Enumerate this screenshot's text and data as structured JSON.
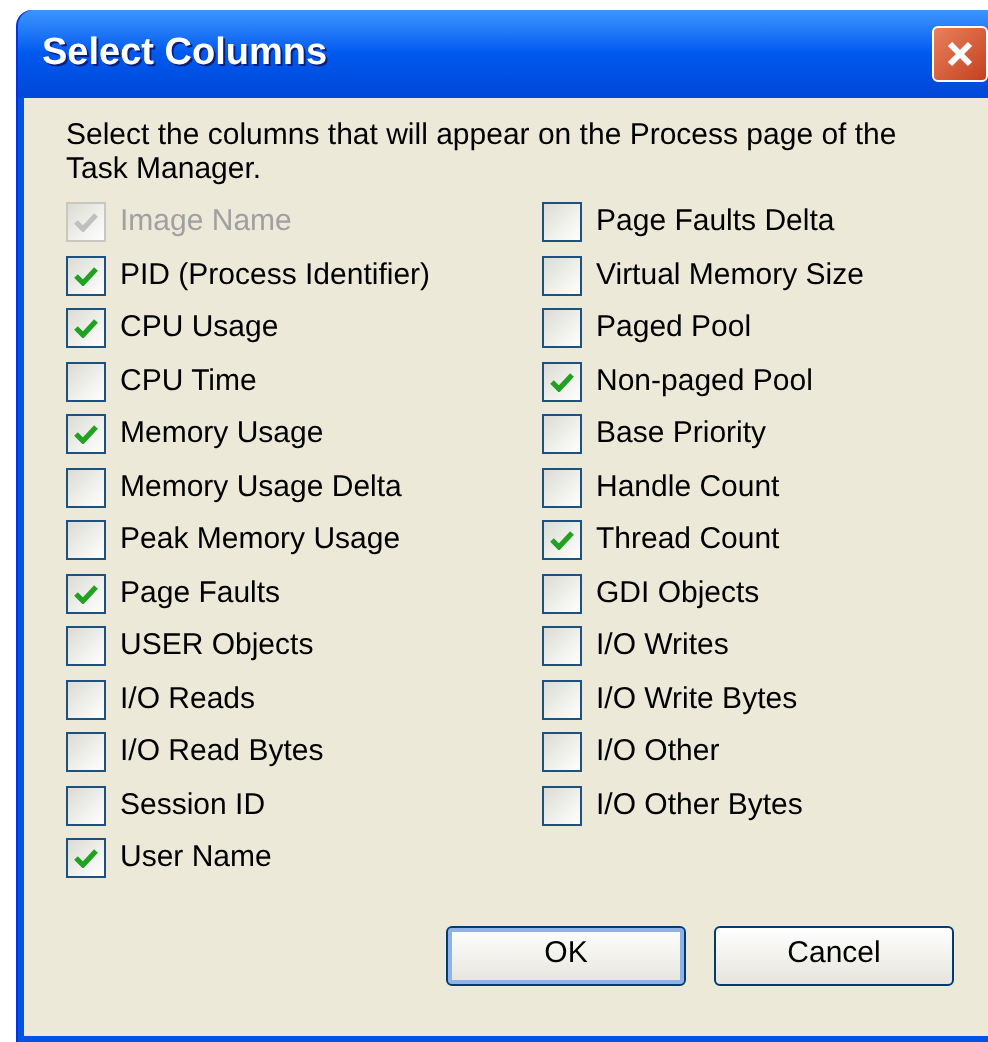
{
  "window": {
    "title": "Select Columns"
  },
  "instructions": "Select the columns that will appear on the Process page of the Task Manager.",
  "columns_left": [
    {
      "label": "Image Name",
      "checked": true,
      "disabled": true
    },
    {
      "label": "PID (Process Identifier)",
      "checked": true,
      "disabled": false
    },
    {
      "label": "CPU Usage",
      "checked": true,
      "disabled": false
    },
    {
      "label": "CPU Time",
      "checked": false,
      "disabled": false
    },
    {
      "label": "Memory Usage",
      "checked": true,
      "disabled": false
    },
    {
      "label": "Memory Usage Delta",
      "checked": false,
      "disabled": false
    },
    {
      "label": "Peak Memory Usage",
      "checked": false,
      "disabled": false
    },
    {
      "label": "Page Faults",
      "checked": true,
      "disabled": false
    },
    {
      "label": "USER Objects",
      "checked": false,
      "disabled": false
    },
    {
      "label": "I/O Reads",
      "checked": false,
      "disabled": false
    },
    {
      "label": "I/O Read Bytes",
      "checked": false,
      "disabled": false
    },
    {
      "label": "Session ID",
      "checked": false,
      "disabled": false
    },
    {
      "label": "User Name",
      "checked": true,
      "disabled": false
    }
  ],
  "columns_right": [
    {
      "label": "Page Faults Delta",
      "checked": false,
      "disabled": false
    },
    {
      "label": "Virtual Memory Size",
      "checked": false,
      "disabled": false
    },
    {
      "label": "Paged Pool",
      "checked": false,
      "disabled": false
    },
    {
      "label": "Non-paged Pool",
      "checked": true,
      "disabled": false
    },
    {
      "label": "Base Priority",
      "checked": false,
      "disabled": false
    },
    {
      "label": "Handle Count",
      "checked": false,
      "disabled": false
    },
    {
      "label": "Thread Count",
      "checked": true,
      "disabled": false
    },
    {
      "label": "GDI Objects",
      "checked": false,
      "disabled": false
    },
    {
      "label": "I/O Writes",
      "checked": false,
      "disabled": false
    },
    {
      "label": "I/O Write Bytes",
      "checked": false,
      "disabled": false
    },
    {
      "label": "I/O Other",
      "checked": false,
      "disabled": false
    },
    {
      "label": "I/O Other Bytes",
      "checked": false,
      "disabled": false
    }
  ],
  "buttons": [
    {
      "label": "OK",
      "default": true
    },
    {
      "label": "Cancel",
      "default": false
    }
  ]
}
